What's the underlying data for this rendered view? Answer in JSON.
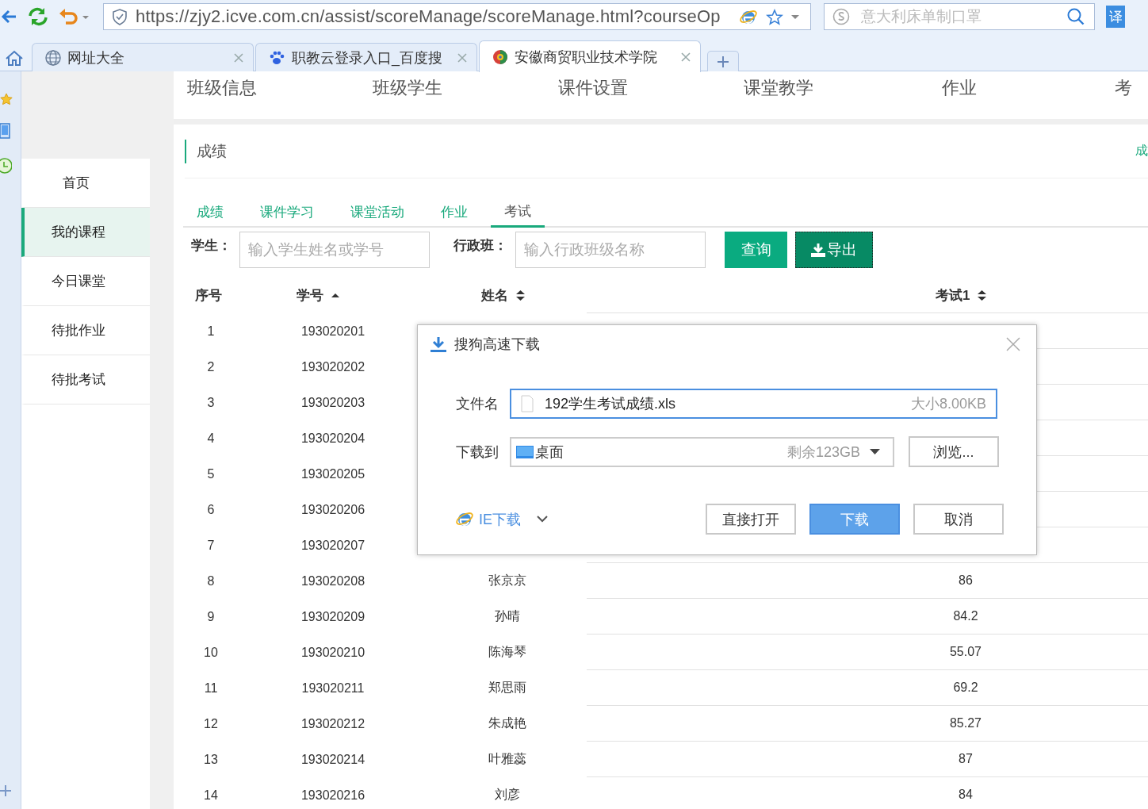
{
  "browser": {
    "url": "https://zjy2.icve.com.cn/assist/scoreManage/scoreManage.html?courseOp",
    "search_placeholder": "意大利床单制口罩",
    "translate_label": "译",
    "tabs": [
      {
        "title": "网址大全",
        "kind": "globe",
        "selected": false
      },
      {
        "title": "职教云登录入口_百度搜",
        "kind": "paw",
        "selected": false
      },
      {
        "title": "安徽商贸职业技术学院",
        "kind": "logo",
        "selected": true
      }
    ]
  },
  "side_nav": [
    {
      "label": "首页",
      "selected": false
    },
    {
      "label": "我的课程",
      "selected": true
    },
    {
      "label": "今日课堂",
      "selected": false
    },
    {
      "label": "待批作业",
      "selected": false
    },
    {
      "label": "待批考试",
      "selected": false
    }
  ],
  "top_nav": [
    "班级信息",
    "班级学生",
    "课件设置",
    "课堂教学",
    "作业",
    "考"
  ],
  "section_title": "成绩",
  "section_link": "成",
  "sub_tabs": [
    {
      "label": "成绩",
      "selected": false
    },
    {
      "label": "课件学习",
      "selected": false
    },
    {
      "label": "课堂活动",
      "selected": false
    },
    {
      "label": "作业",
      "selected": false
    },
    {
      "label": "考试",
      "selected": true
    }
  ],
  "filters": {
    "student_label": "学生：",
    "student_placeholder": "输入学生姓名或学号",
    "class_label": "行政班：",
    "class_placeholder": "输入行政班级名称"
  },
  "buttons": {
    "query": "查询",
    "export": "导出"
  },
  "table": {
    "columns": [
      {
        "label": "序号",
        "kind": "plain"
      },
      {
        "label": "学号",
        "kind": "ascending"
      },
      {
        "label": "姓名",
        "kind": "sortable"
      },
      {
        "label": "考试1",
        "kind": "sortable"
      }
    ],
    "rows": [
      {
        "index": "1",
        "student_id": "193020201"
      },
      {
        "index": "2",
        "student_id": "193020202"
      },
      {
        "index": "3",
        "student_id": "193020203"
      },
      {
        "index": "4",
        "student_id": "193020204"
      },
      {
        "index": "5",
        "student_id": "193020205"
      },
      {
        "index": "6",
        "student_id": "193020206"
      },
      {
        "index": "7",
        "student_id": "193020207"
      },
      {
        "index": "8",
        "student_id": "193020208",
        "name": "张京京",
        "score": "86"
      },
      {
        "index": "9",
        "student_id": "193020209",
        "name": "孙晴",
        "score": "84.2"
      },
      {
        "index": "10",
        "student_id": "193020210",
        "name": "陈海琴",
        "score": "55.07"
      },
      {
        "index": "11",
        "student_id": "193020211",
        "name": "郑思雨",
        "score": "69.2"
      },
      {
        "index": "12",
        "student_id": "193020212",
        "name": "朱成艳",
        "score": "85.27"
      },
      {
        "index": "13",
        "student_id": "193020214",
        "name": "叶雅蕊",
        "score": "87"
      },
      {
        "index": "14",
        "student_id": "193020216",
        "name": "刘彦",
        "score": "84"
      }
    ]
  },
  "dialog": {
    "title": "搜狗高速下载",
    "file_label": "文件名",
    "file_name": "192学生考试成绩.xls",
    "file_size": "大小8.00KB",
    "dest_label": "下载到",
    "dest": "桌面",
    "free_space": "剩余123GB",
    "browse": "浏览...",
    "ie_download": "IE下载",
    "buttons": [
      {
        "label": "直接打开",
        "primary": false
      },
      {
        "label": "下载",
        "primary": true
      },
      {
        "label": "取消",
        "primary": false
      }
    ]
  }
}
